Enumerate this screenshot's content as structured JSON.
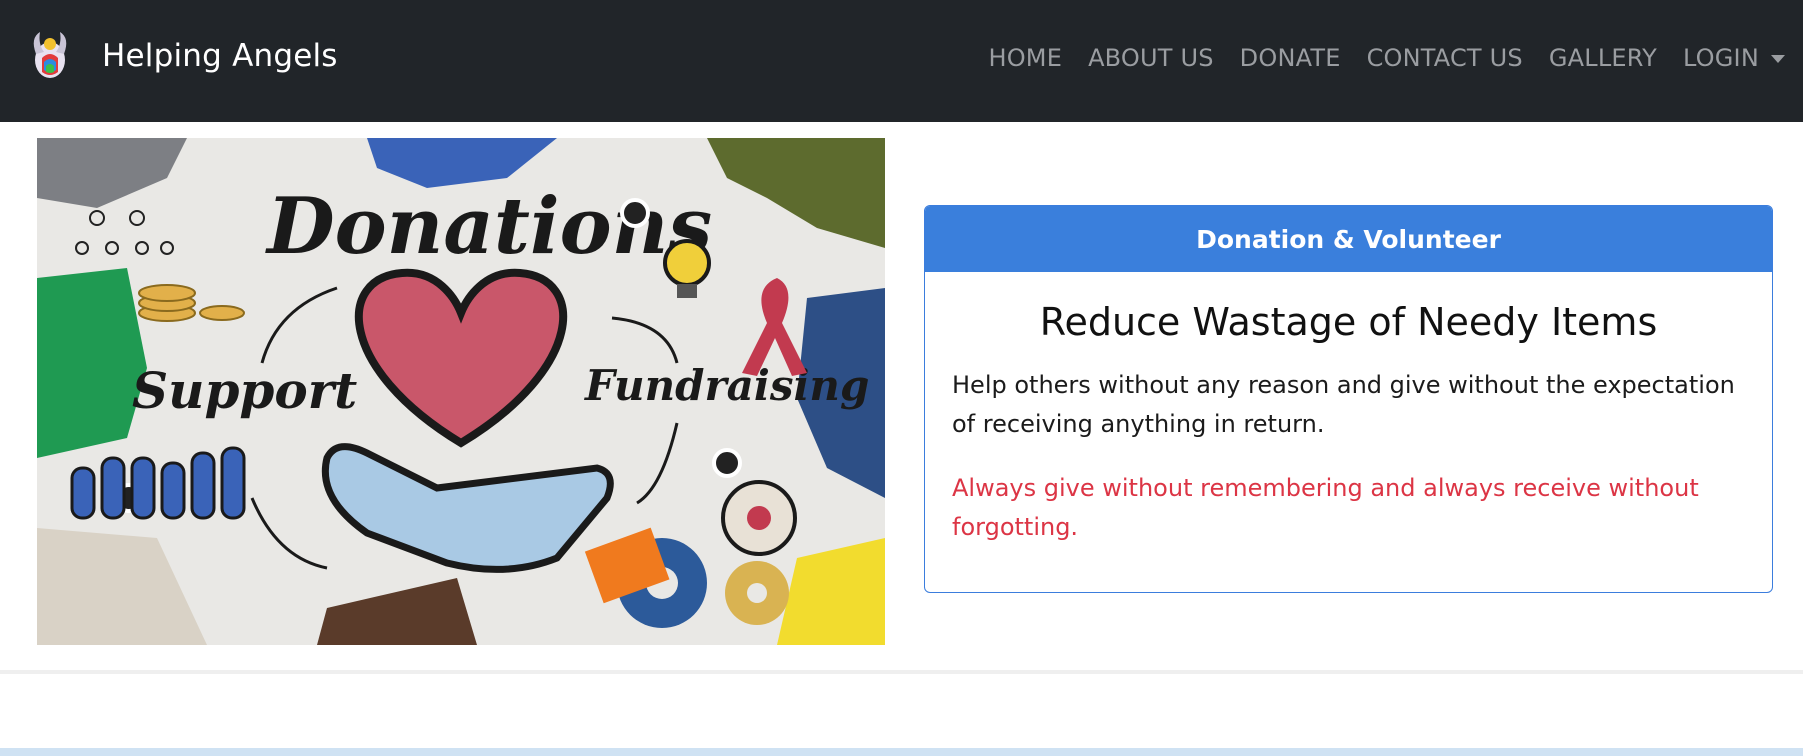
{
  "brand": {
    "name": "Helping Angels",
    "logo_icon": "angel-logo-icon"
  },
  "nav": {
    "items": [
      {
        "label": "HOME"
      },
      {
        "label": "ABOUT US"
      },
      {
        "label": "DONATE"
      },
      {
        "label": "CONTACT US"
      },
      {
        "label": "GALLERY"
      },
      {
        "label": "LOGIN"
      }
    ]
  },
  "hero": {
    "image_words": [
      "Donations",
      "Support",
      "Fundraising"
    ]
  },
  "card": {
    "header": "Donation & Volunteer",
    "title": "Reduce Wastage of Needy Items",
    "text": "Help others without any reason and give without the expectation of receiving anything in return.",
    "quote": "Always give without remembering and always receive without forgotting."
  },
  "colors": {
    "navbar_bg": "#212529",
    "card_header_bg": "#3a7fdc",
    "quote_red": "#dc3545",
    "nav_link": "#9a9da1"
  }
}
